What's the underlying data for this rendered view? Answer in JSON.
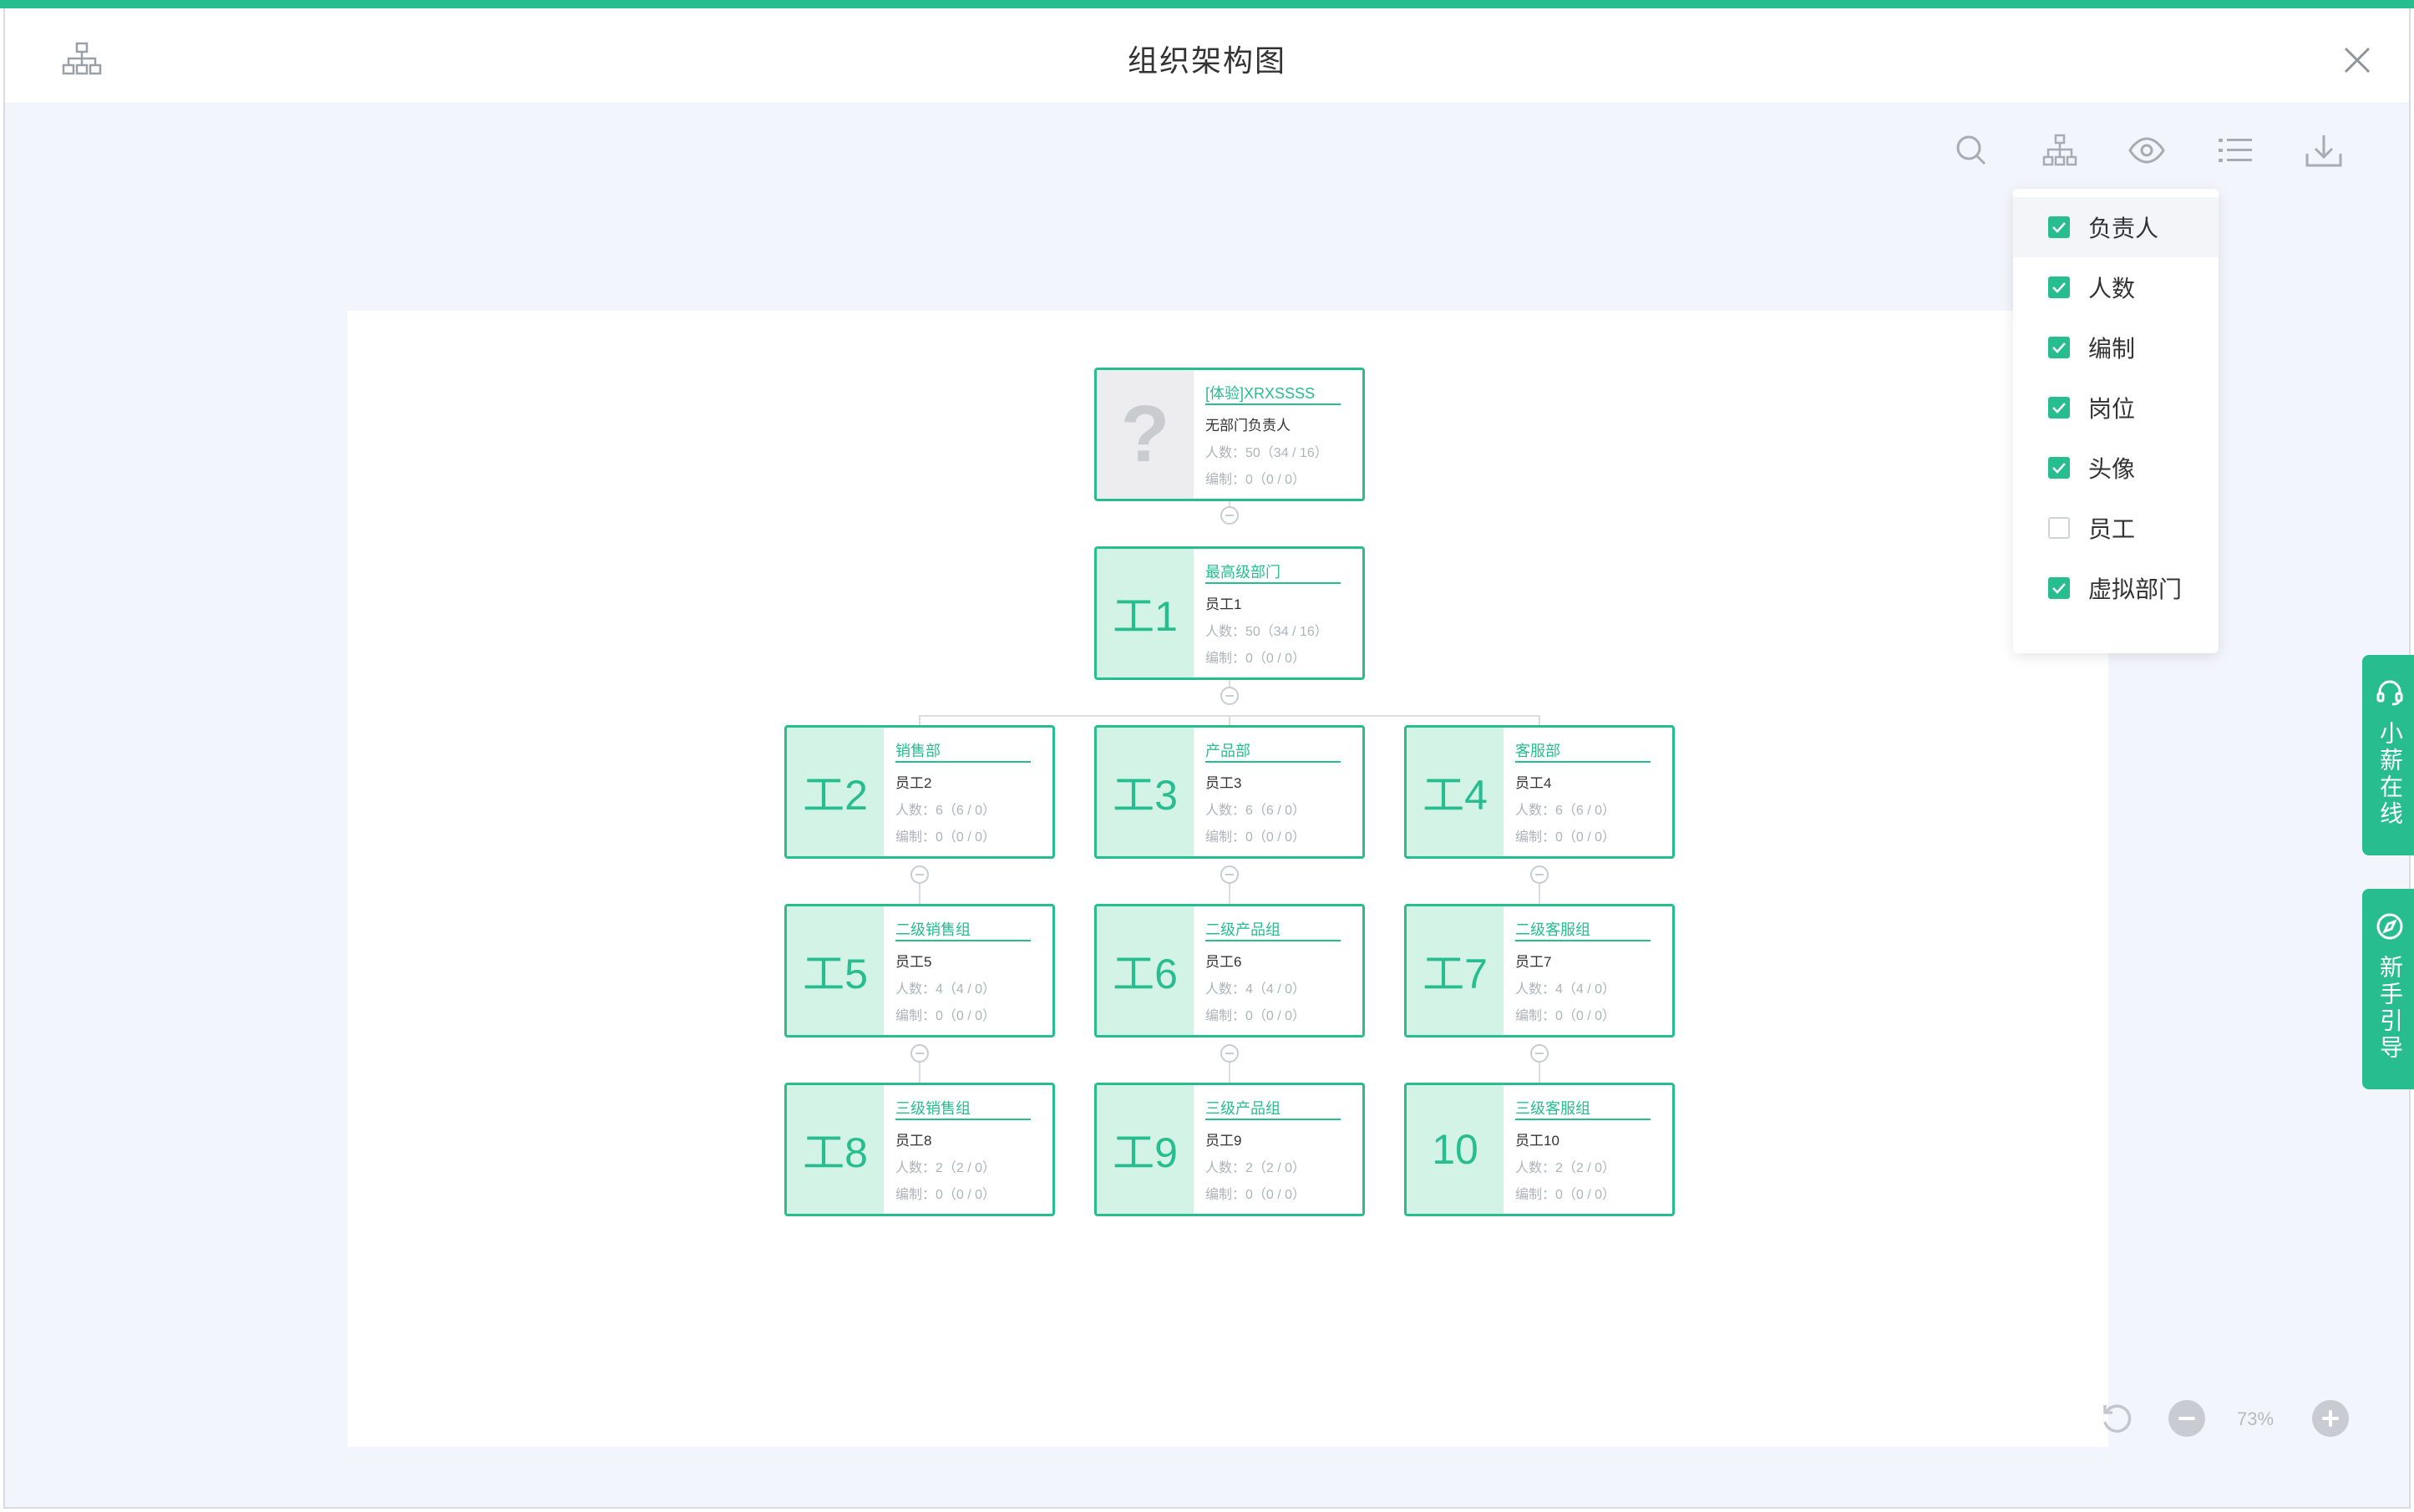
{
  "header": {
    "title": "组织架构图",
    "left_icon": "org-chart-icon",
    "close_icon": "close-icon"
  },
  "toolbar": {
    "items": [
      "search-icon",
      "org-structure-icon",
      "eye-icon",
      "list-icon",
      "download-icon"
    ]
  },
  "display_menu": {
    "items": [
      {
        "label": "负责人",
        "checked": true
      },
      {
        "label": "人数",
        "checked": true
      },
      {
        "label": "编制",
        "checked": true
      },
      {
        "label": "岗位",
        "checked": true
      },
      {
        "label": "头像",
        "checked": true
      },
      {
        "label": "员工",
        "checked": false
      },
      {
        "label": "虚拟部门",
        "checked": true
      }
    ]
  },
  "side_tabs": [
    {
      "label": "小薪在线",
      "icon": "headset-icon"
    },
    {
      "label": "新手引导",
      "icon": "compass-icon"
    }
  ],
  "zoom": {
    "value": "73%"
  },
  "colors": {
    "accent": "#27bd8f",
    "avatar_bg": "#d4f3e7",
    "canvas_bg": "#f2f5fb"
  },
  "org": {
    "root": {
      "avatar": "?",
      "dept": "[体验]XRXSSSS",
      "leader": "无部门负责人",
      "headcount": "人数：50（34 / 16）",
      "quota": "编制：0（0 / 0）"
    },
    "top": {
      "avatar": "工1",
      "dept": "最高级部门",
      "leader": "员工1",
      "headcount": "人数：50（34 / 16）",
      "quota": "编制：0（0 / 0）"
    },
    "level2": [
      {
        "avatar": "工2",
        "dept": "销售部",
        "leader": "员工2",
        "headcount": "人数：6（6 / 0）",
        "quota": "编制：0（0 / 0）"
      },
      {
        "avatar": "工3",
        "dept": "产品部",
        "leader": "员工3",
        "headcount": "人数：6（6 / 0）",
        "quota": "编制：0（0 / 0）"
      },
      {
        "avatar": "工4",
        "dept": "客服部",
        "leader": "员工4",
        "headcount": "人数：6（6 / 0）",
        "quota": "编制：0（0 / 0）"
      }
    ],
    "level3": [
      {
        "avatar": "工5",
        "dept": "二级销售组",
        "leader": "员工5",
        "headcount": "人数：4（4 / 0）",
        "quota": "编制：0（0 / 0）"
      },
      {
        "avatar": "工6",
        "dept": "二级产品组",
        "leader": "员工6",
        "headcount": "人数：4（4 / 0）",
        "quota": "编制：0（0 / 0）"
      },
      {
        "avatar": "工7",
        "dept": "二级客服组",
        "leader": "员工7",
        "headcount": "人数：4（4 / 0）",
        "quota": "编制：0（0 / 0）"
      }
    ],
    "level4": [
      {
        "avatar": "工8",
        "dept": "三级销售组",
        "leader": "员工8",
        "headcount": "人数：2（2 / 0）",
        "quota": "编制：0（0 / 0）"
      },
      {
        "avatar": "工9",
        "dept": "三级产品组",
        "leader": "员工9",
        "headcount": "人数：2（2 / 0）",
        "quota": "编制：0（0 / 0）"
      },
      {
        "avatar": "10",
        "dept": "三级客服组",
        "leader": "员工10",
        "headcount": "人数：2（2 / 0）",
        "quota": "编制：0（0 / 0）"
      }
    ]
  }
}
